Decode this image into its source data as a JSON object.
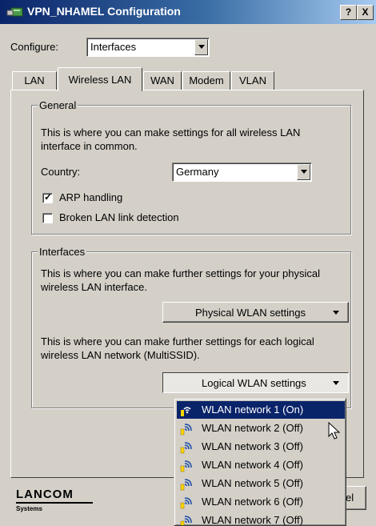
{
  "window": {
    "title": "VPN_NHAMEL Configuration",
    "help_label": "?",
    "close_label": "X"
  },
  "configure": {
    "label": "Configure:",
    "value": "Interfaces"
  },
  "tabs": [
    {
      "label": "LAN"
    },
    {
      "label": "Wireless LAN",
      "active": true
    },
    {
      "label": "WAN"
    },
    {
      "label": "Modem"
    },
    {
      "label": "VLAN"
    }
  ],
  "general": {
    "legend": "General",
    "description": "This is where you can make settings for all wireless LAN interface in common.",
    "country_label": "Country:",
    "country_value": "Germany",
    "arp_label": "ARP handling",
    "arp_checked": true,
    "broken_link_label": "Broken LAN link detection",
    "broken_link_checked": false
  },
  "interfaces": {
    "legend": "Interfaces",
    "physical_description": "This is where you can make further settings for your physical wireless LAN interface.",
    "physical_button": "Physical WLAN settings",
    "logical_description": "This is where you can make further settings for each logical wireless LAN network (MultiSSID).",
    "logical_button": "Logical WLAN settings"
  },
  "menu": {
    "items": [
      {
        "label": "WLAN network 1 (On)",
        "selected": true,
        "icon": "wlan-on-icon"
      },
      {
        "label": "WLAN network 2 (Off)",
        "icon": "wlan-off-icon"
      },
      {
        "label": "WLAN network 3 (Off)",
        "icon": "wlan-off-icon"
      },
      {
        "label": "WLAN network 4 (Off)",
        "icon": "wlan-off-icon"
      },
      {
        "label": "WLAN network 5 (Off)",
        "icon": "wlan-off-icon"
      },
      {
        "label": "WLAN network 6 (Off)",
        "icon": "wlan-off-icon"
      },
      {
        "label": "WLAN network 7 (Off)",
        "icon": "wlan-off-icon"
      }
    ]
  },
  "footer": {
    "logo_text": "LANCOM",
    "logo_subtext": "Systems",
    "cancel_fragment": "el"
  },
  "colors": {
    "titlebar": "#0a246a",
    "face": "#d4d0c8",
    "selection": "#0a246a"
  }
}
